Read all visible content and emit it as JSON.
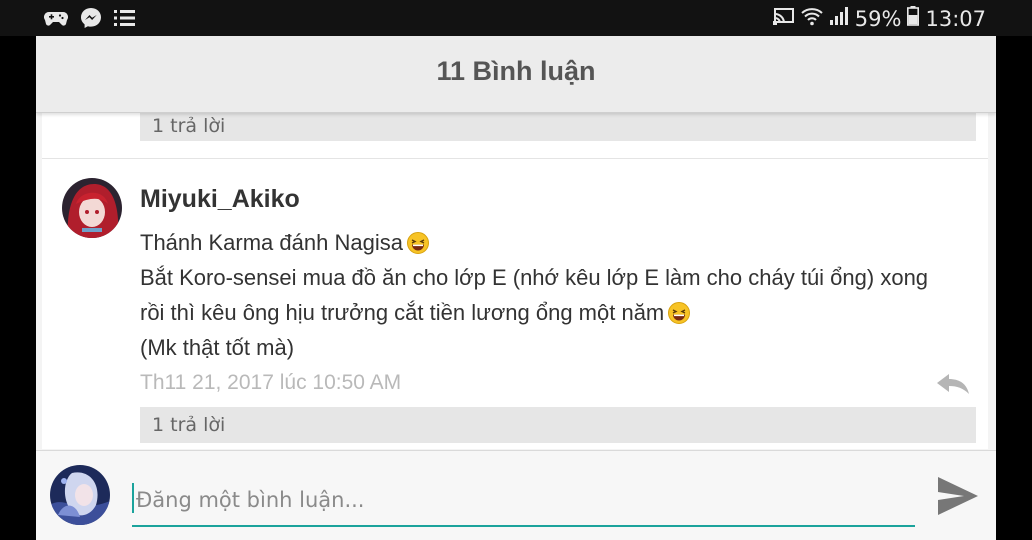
{
  "status_bar": {
    "battery": "59%",
    "time": "13:07"
  },
  "header": {
    "title": "11 Bình luận"
  },
  "comments": [
    {
      "reply_count_label": "1 trả lời"
    },
    {
      "author": "Miyuki_Akiko",
      "lines": [
        "Thánh Karma đánh Nagisa",
        "Bắt Koro-sensei mua đồ ăn cho lớp E (nhớ kêu lớp E làm cho cháy túi ổng) xong",
        "rồi thì kêu ông hịu trưởng cắt tiền lương ổng một năm",
        "(Mk thật tốt mà)"
      ],
      "timestamp": "Th11 21, 2017 lúc 10:50 AM",
      "reply_count_label": "1 trả lời"
    }
  ],
  "composer": {
    "placeholder": "Đăng một bình luận...",
    "value": ""
  },
  "icons": {
    "status_left": [
      "gamepad-icon",
      "messenger-icon",
      "list-icon"
    ],
    "status_right": [
      "cast-icon",
      "wifi-icon",
      "signal-icon",
      "battery-icon"
    ],
    "emoji": "laughing-emoji-icon",
    "reply": "reply-arrow-icon",
    "send": "send-icon"
  },
  "colors": {
    "accent": "#1ba39c",
    "header_bg": "#ececec",
    "reply_bar_bg": "#e6e6e6"
  }
}
